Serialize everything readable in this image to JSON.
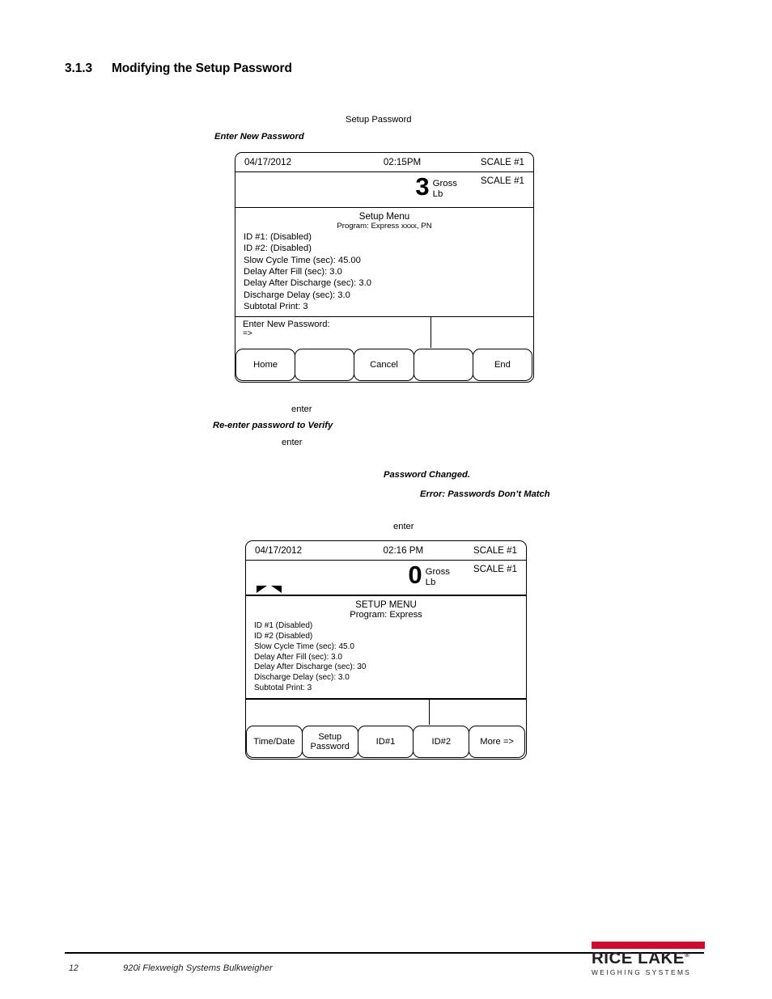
{
  "section": {
    "number": "3.1.3",
    "title": "Modifying the Setup Password"
  },
  "annotations": {
    "setup_password": "Setup Password",
    "enter_new_password": "Enter New Password",
    "enter_1": "enter",
    "re_enter_verify": "Re-enter password to Verify",
    "enter_2": "enter",
    "password_changed": "Password Changed.",
    "error_mismatch": "Error: Passwords Don’t Match",
    "enter_3": "enter"
  },
  "panel1": {
    "status": {
      "date": "04/17/2012",
      "time": "02:15PM",
      "scale": "SCALE #1"
    },
    "display": {
      "weight": "3",
      "mode": "Gross",
      "units": "Lb",
      "scale": "SCALE #1"
    },
    "menu": {
      "title": "Setup Menu",
      "subtitle": "Program: Express xxxx, PN",
      "items": [
        "ID #1: (Disabled)",
        "ID #2: (Disabled)",
        "Slow Cycle Time (sec): 45.00",
        "Delay After Fill (sec): 3.0",
        "Delay After Discharge (sec): 3.0",
        "Discharge Delay (sec): 3.0",
        "Subtotal Print: 3"
      ]
    },
    "prompt": {
      "label": "Enter New Password:",
      "cursor": "=>"
    },
    "softkeys": [
      "Home",
      "",
      "Cancel",
      "",
      "End"
    ]
  },
  "panel2": {
    "status": {
      "date": "04/17/2012",
      "time": "02:16 PM",
      "scale": "SCALE #1"
    },
    "display": {
      "weight": "0",
      "mode": "Gross",
      "units": "Lb",
      "scale": "SCALE #1"
    },
    "menu": {
      "title": "SETUP MENU",
      "subtitle": "Program: Express",
      "items": [
        "ID #1 (Disabled)",
        "ID #2 (Disabled)",
        "Slow Cycle Time (sec): 45.0",
        "Delay After Fill (sec): 3.0",
        "Delay After Discharge (sec): 30",
        "Discharge Delay (sec): 3.0",
        "Subtotal Print: 3"
      ]
    },
    "softkeys": [
      "Time/Date",
      "Setup\nPassword",
      "ID#1",
      "ID#2",
      "More =>"
    ]
  },
  "footer": {
    "page": "12",
    "title": "920i Flexweigh Systems Bulkweigher",
    "logo_name": "RICE LAKE",
    "logo_reg": "®",
    "logo_sub": "WEIGHING SYSTEMS",
    "logo_color": "#cc0a2f"
  }
}
